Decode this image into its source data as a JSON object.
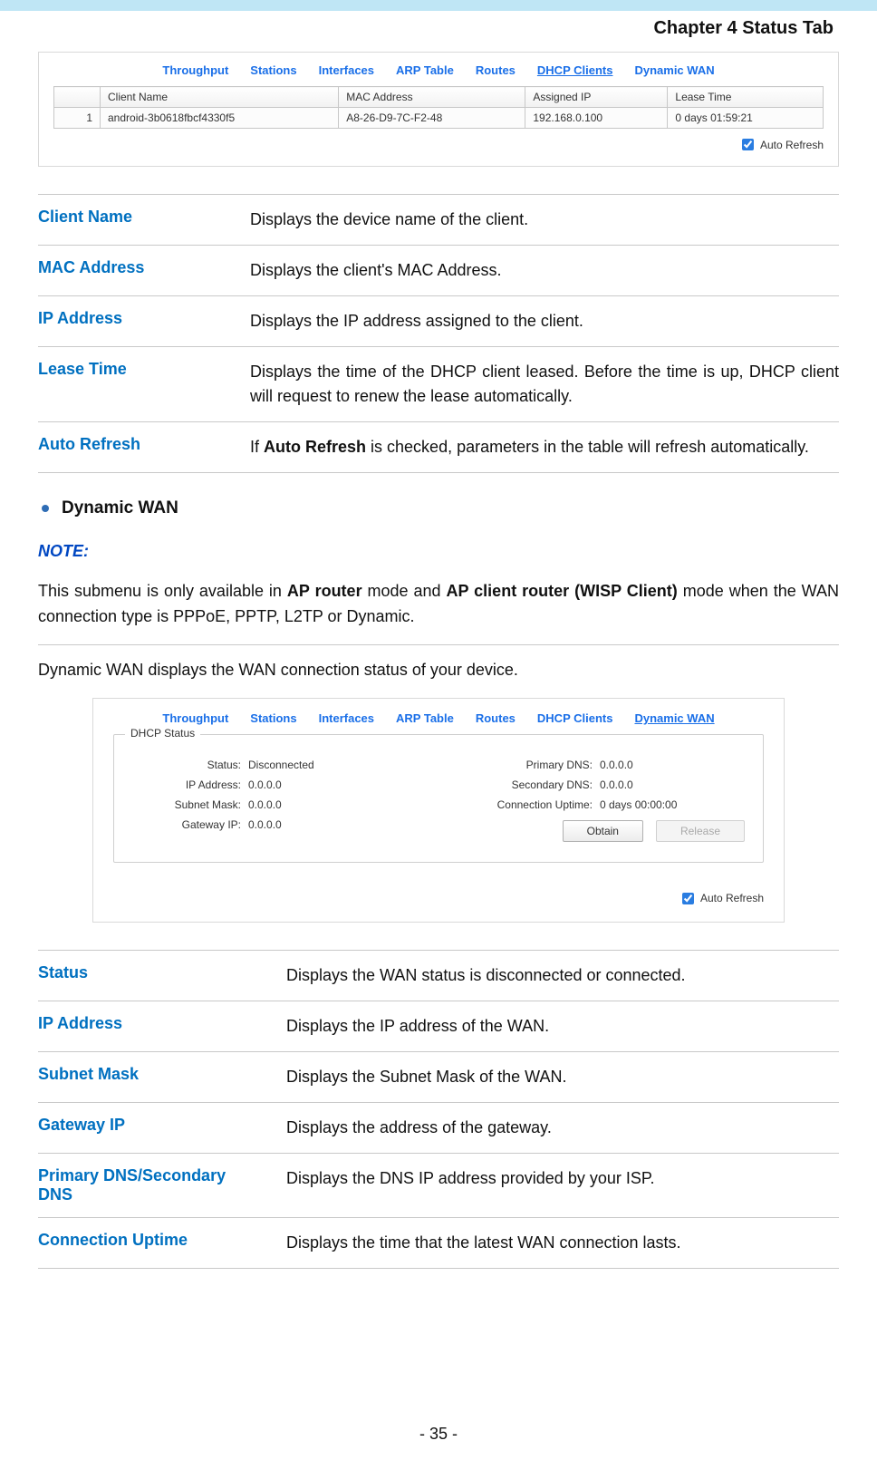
{
  "chapter_title": "Chapter 4 Status Tab",
  "page_number": "- 35 -",
  "dhcp_clients_panel": {
    "tabs": [
      "Throughput",
      "Stations",
      "Interfaces",
      "ARP Table",
      "Routes",
      "DHCP Clients",
      "Dynamic WAN"
    ],
    "active_tab": "DHCP Clients",
    "auto_refresh_label": "Auto Refresh",
    "columns": [
      "",
      "Client Name",
      "MAC Address",
      "Assigned IP",
      "Lease Time"
    ],
    "rows": [
      {
        "n": "1",
        "client_name": "android-3b0618fbcf4330f5",
        "mac": "A8-26-D9-7C-F2-48",
        "ip": "192.168.0.100",
        "lease": "0 days 01:59:21"
      }
    ]
  },
  "dhcp_defs": [
    {
      "term": "Client Name",
      "desc": "Displays the device name of the client."
    },
    {
      "term": "MAC Address",
      "desc": "Displays the client's MAC Address."
    },
    {
      "term": "IP Address",
      "desc": "Displays the IP address assigned to the client."
    },
    {
      "term": "Lease Time",
      "desc": "Displays the time of the DHCP client leased. Before the time is up, DHCP client will request to renew the lease automatically."
    },
    {
      "term": "Auto Refresh",
      "desc_prefix": "If ",
      "desc_bold": "Auto Refresh",
      "desc_suffix": " is checked, parameters in the table will refresh automatically."
    }
  ],
  "dynamic_wan_heading": "Dynamic WAN",
  "note_label": "NOTE:",
  "note_text_parts": {
    "p1": "This submenu is only available in ",
    "b1": "AP router",
    "p2": " mode and ",
    "b2": "AP client router (WISP Client)",
    "p3": " mode when the WAN connection type is PPPoE, PPTP, L2TP or Dynamic."
  },
  "dynamic_wan_intro": "Dynamic WAN displays the WAN connection status of your device.",
  "dynamic_wan_panel": {
    "tabs": [
      "Throughput",
      "Stations",
      "Interfaces",
      "ARP Table",
      "Routes",
      "DHCP Clients",
      "Dynamic WAN"
    ],
    "active_tab": "Dynamic WAN",
    "auto_refresh_label": "Auto Refresh",
    "legend": "DHCP Status",
    "left": [
      {
        "label": "Status:",
        "value": "Disconnected"
      },
      {
        "label": "IP Address:",
        "value": "0.0.0.0"
      },
      {
        "label": "Subnet Mask:",
        "value": "0.0.0.0"
      },
      {
        "label": "Gateway IP:",
        "value": "0.0.0.0"
      }
    ],
    "right": [
      {
        "label": "Primary DNS:",
        "value": "0.0.0.0"
      },
      {
        "label": "Secondary DNS:",
        "value": "0.0.0.0"
      },
      {
        "label": "Connection Uptime:",
        "value": "0 days 00:00:00"
      }
    ],
    "buttons": {
      "obtain": "Obtain",
      "release": "Release"
    }
  },
  "wan_defs": [
    {
      "term": "Status",
      "desc": "Displays the WAN status is disconnected or connected."
    },
    {
      "term": "IP Address",
      "desc": "Displays the IP address of the WAN."
    },
    {
      "term": "Subnet Mask",
      "desc": "Displays the Subnet Mask of the WAN."
    },
    {
      "term": "Gateway IP",
      "desc": "Displays the address of the gateway."
    },
    {
      "term": "Primary DNS/Secondary DNS",
      "desc": "Displays the DNS IP address provided by your ISP."
    },
    {
      "term": "Connection Uptime",
      "desc": "Displays the time that the latest WAN connection lasts."
    }
  ]
}
